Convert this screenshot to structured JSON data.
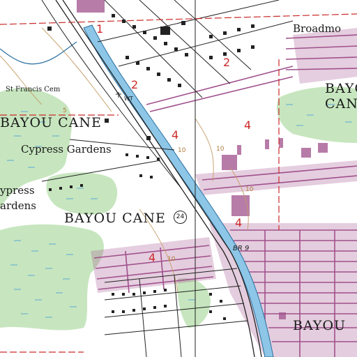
{
  "map": {
    "labels": {
      "broadmoor": "Broadmo",
      "st_francis_cem": "St Francis Cem",
      "bayou_cane_left": "BAYOU CANE",
      "cypress_gardens_top": "Cypress Gardens",
      "cypress_gardens_left_1": "ypress",
      "cypress_gardens_left_2": "ardens",
      "bayou_cane_center": "BAYOU CANE",
      "bayou_cane_right_1": "BAYO",
      "bayou_cane_right_2": "CAN",
      "bayou_bottom": "BAYOU",
      "route_24": "24",
      "br_9": "BR 9",
      "wt": "WT",
      "contour_10_a": "10",
      "contour_10_b": "10",
      "contour_10_c": "10",
      "contour_5": "5",
      "contour_10_d": "10"
    },
    "section_numbers": {
      "s1": "1",
      "s2a": "2",
      "s2b": "2",
      "s4a": "4",
      "s4b": "4",
      "s4c": "4",
      "s4d": "4"
    },
    "colors": {
      "urban_purple": "#a0508c",
      "vegetation_green": "#c7e6bf",
      "marsh_blue": "#6fb2d2",
      "water_blue": "#8dc6e6",
      "section_red": "#cc2a2a",
      "contour_brown": "#c49a63",
      "road_black": "#222222"
    }
  }
}
